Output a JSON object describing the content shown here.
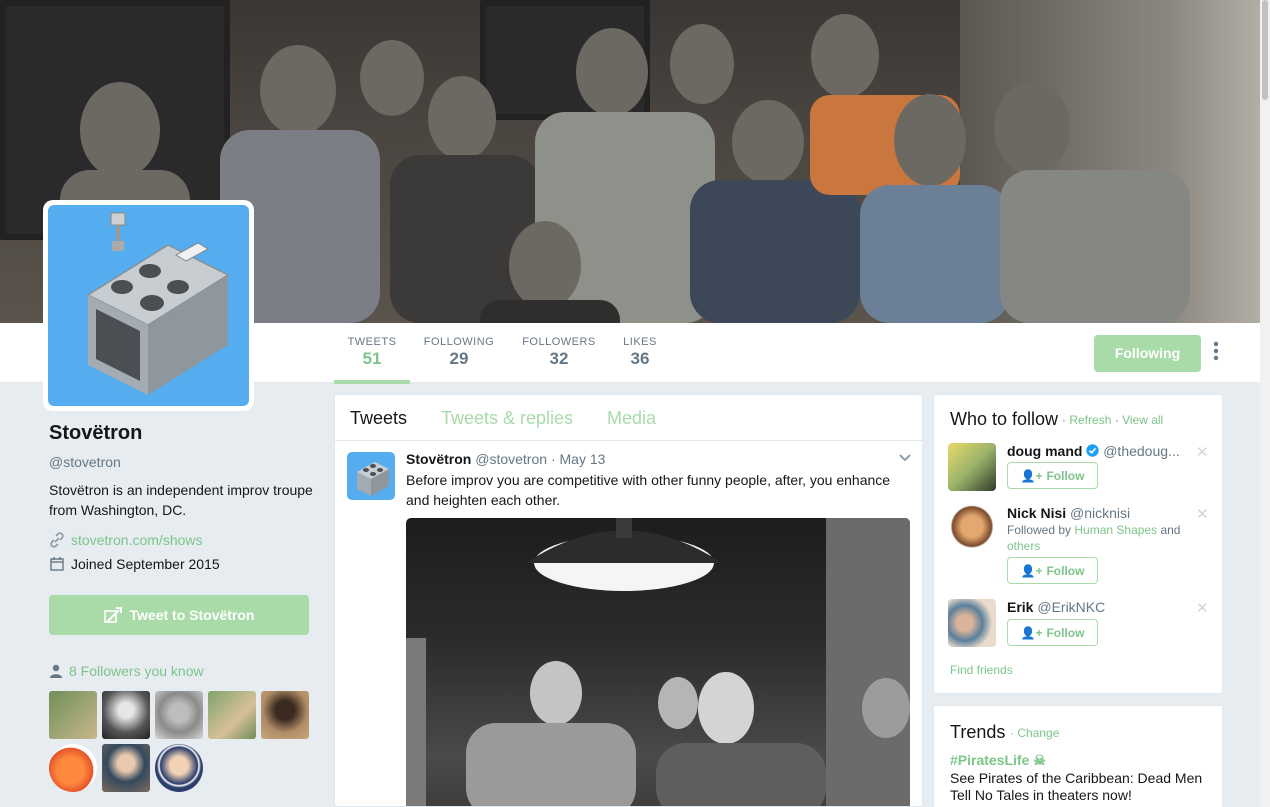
{
  "profile": {
    "name": "Stovëtron",
    "handle": "@stovetron",
    "bio": "Stovëtron is an independent improv troupe from Washington, DC.",
    "website": "stovetron.com/shows",
    "joined": "Joined September 2015",
    "tweet_to_label": "Tweet to Stovëtron",
    "followers_you_know": "8 Followers you know"
  },
  "nav": {
    "stats": [
      {
        "label": "TWEETS",
        "value": "51"
      },
      {
        "label": "FOLLOWING",
        "value": "29"
      },
      {
        "label": "FOLLOWERS",
        "value": "32"
      },
      {
        "label": "LIKES",
        "value": "36"
      }
    ],
    "following_button": "Following"
  },
  "timeline": {
    "tabs": [
      "Tweets",
      "Tweets & replies",
      "Media"
    ],
    "tweet": {
      "name": "Stovëtron",
      "handle": "@stovetron",
      "date": "May 13",
      "dot": "·",
      "text": "Before improv you are competitive with other funny people, after, you enhance and heighten each other."
    }
  },
  "who_to_follow": {
    "title": "Who to follow",
    "refresh": "Refresh",
    "view_all": "View all",
    "sep": "·",
    "follow_label": "Follow",
    "users": [
      {
        "name": "doug mand",
        "handle": "@thedoug...",
        "followed_by": ""
      },
      {
        "name": "Nick Nisi",
        "handle": "@nicknisi",
        "followed_by_prefix": "Followed by",
        "followed_by_link": "Human Shapes",
        "followed_by_and": "and",
        "followed_by_others": "others"
      },
      {
        "name": "Erik",
        "handle": "@ErikNKC",
        "followed_by": ""
      }
    ],
    "find_friends": "Find friends"
  },
  "trends": {
    "title": "Trends",
    "change": "· Change",
    "items": [
      {
        "tag": "#PiratesLife",
        "desc": "See Pirates of the Caribbean: Dead Men Tell No Tales in theaters now!"
      }
    ]
  },
  "colors": {
    "accent": "#a8dba8",
    "accent_text": "#7dc58a",
    "avatar_blue": "#55acee"
  }
}
